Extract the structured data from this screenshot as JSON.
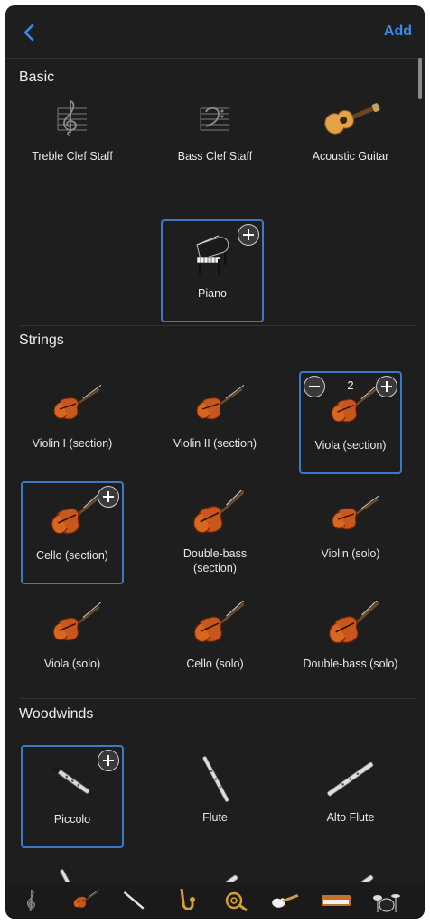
{
  "nav": {
    "back_icon": "chevron-left-icon",
    "add_label": "Add"
  },
  "sections": {
    "basic": {
      "title": "Basic",
      "items": [
        {
          "label": "Treble Clef Staff",
          "icon": "treble-clef-icon"
        },
        {
          "label": "Bass Clef Staff",
          "icon": "bass-clef-icon"
        },
        {
          "label": "Acoustic Guitar",
          "icon": "acoustic-guitar-icon"
        },
        {
          "label": "Piano",
          "icon": "grand-piano-icon",
          "selected": true
        }
      ]
    },
    "strings": {
      "title": "Strings",
      "items": [
        {
          "label": "Violin I (section)",
          "icon": "violin-icon"
        },
        {
          "label": "Violin II (section)",
          "icon": "violin-icon"
        },
        {
          "label": "Viola (section)",
          "icon": "viola-icon",
          "selected": true,
          "count": "2"
        },
        {
          "label": "Cello (section)",
          "icon": "cello-icon",
          "selected": true
        },
        {
          "label": "Double-bass (section)",
          "icon": "double-bass-icon"
        },
        {
          "label": "Violin (solo)",
          "icon": "violin-icon"
        },
        {
          "label": "Viola (solo)",
          "icon": "viola-icon"
        },
        {
          "label": "Cello (solo)",
          "icon": "cello-icon"
        },
        {
          "label": "Double-bass (solo)",
          "icon": "double-bass-icon"
        }
      ]
    },
    "woodwinds": {
      "title": "Woodwinds",
      "items": [
        {
          "label": "Piccolo",
          "icon": "piccolo-icon",
          "selected": true
        },
        {
          "label": "Flute",
          "icon": "flute-icon"
        },
        {
          "label": "Alto Flute",
          "icon": "alto-flute-icon"
        }
      ]
    }
  },
  "bottom_bar": {
    "categories": [
      "treble-clef-icon",
      "violin-icon",
      "flute-icon",
      "saxophone-icon",
      "french-horn-icon",
      "electric-guitar-icon",
      "keyboard-icon",
      "drum-kit-icon"
    ]
  },
  "colors": {
    "background": "#1e1e1f",
    "accent": "#3b8ae6",
    "selection": "#3b78c6"
  }
}
